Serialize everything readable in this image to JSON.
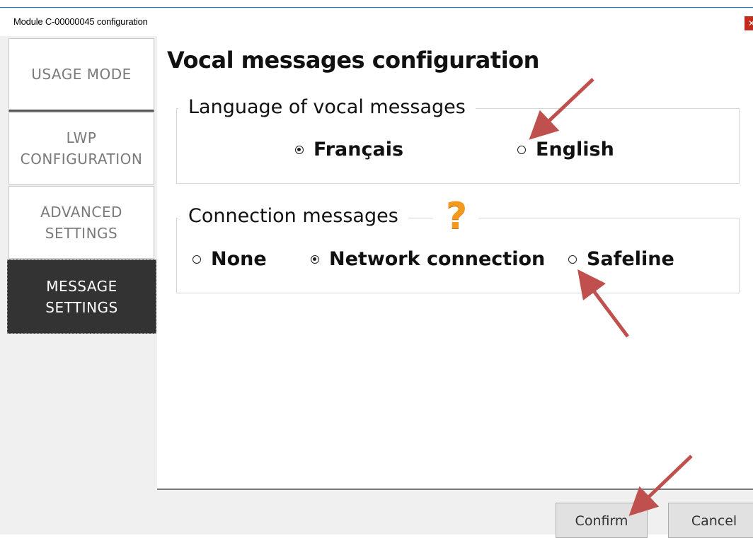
{
  "window": {
    "title": "Module C-00000045 configuration",
    "close_label": "✕"
  },
  "sidebar": {
    "items": [
      {
        "label": "USAGE MODE"
      },
      {
        "label": "LWP\nCONFIGURATION"
      },
      {
        "label": "ADVANCED\nSETTINGS"
      },
      {
        "label": "MESSAGE\nSETTINGS"
      }
    ]
  },
  "main": {
    "title": "Vocal messages configuration",
    "language_group": {
      "legend": "Language of vocal messages",
      "options": [
        {
          "label": "Français",
          "checked": true
        },
        {
          "label": "English",
          "checked": false
        }
      ]
    },
    "connection_group": {
      "legend": "Connection messages",
      "help_icon": "?",
      "options": [
        {
          "label": "None",
          "checked": false
        },
        {
          "label": "Network connection",
          "checked": true
        },
        {
          "label": "Safeline",
          "checked": false
        }
      ]
    }
  },
  "footer": {
    "confirm_label": "Confirm",
    "cancel_label": "Cancel"
  },
  "colors": {
    "annotation_arrow": "#c0504d",
    "help_icon": "#f39a1e",
    "active_nav": "#333333"
  }
}
